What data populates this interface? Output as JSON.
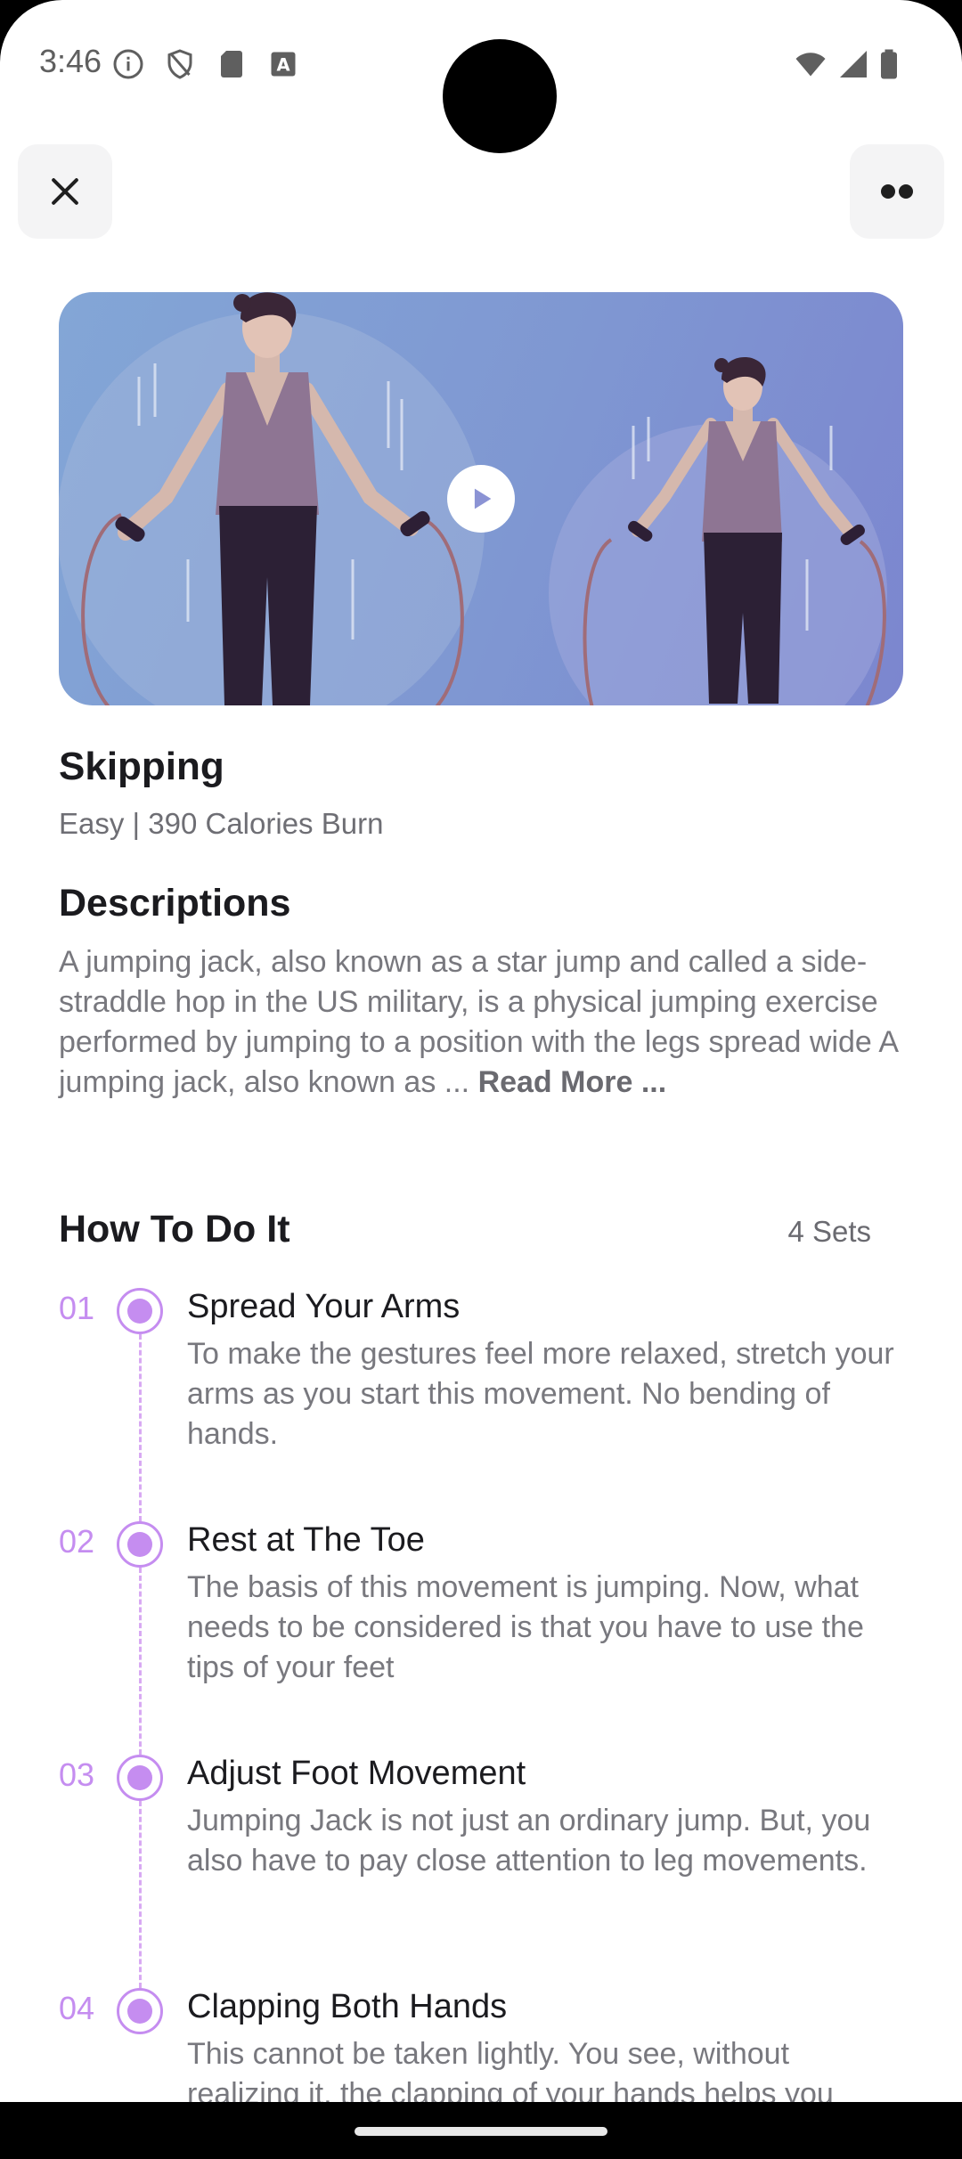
{
  "status": {
    "time": "3:46"
  },
  "exercise": {
    "title": "Skipping",
    "subtitle": "Easy | 390 Calories Burn"
  },
  "descriptions": {
    "heading": "Descriptions",
    "text": "A jumping jack, also known as a star jump and called a side-straddle hop in the US military, is a physical jumping exercise performed by jumping to a position with the legs spread wide A jumping jack, also known as ... ",
    "read_more": "Read More ..."
  },
  "howto": {
    "heading": "How To Do It",
    "sets": "4 Sets",
    "steps": [
      {
        "num": "01",
        "title": "Spread Your Arms",
        "text": "To make the gestures feel more relaxed, stretch your arms as you start this movement. No bending of hands."
      },
      {
        "num": "02",
        "title": "Rest at The Toe",
        "text": "The basis of this movement is jumping. Now, what needs to be considered is that you have to use the tips of your feet"
      },
      {
        "num": "03",
        "title": "Adjust Foot Movement",
        "text": "Jumping Jack is not just an ordinary jump. But, you also have to pay close attention to leg movements."
      },
      {
        "num": "04",
        "title": "Clapping Both Hands",
        "text": "This cannot be taken lightly. You see, without realizing it, the clapping of your hands helps you"
      }
    ]
  },
  "icons": {
    "close": "close-icon",
    "more": "more-icon",
    "play": "play-icon"
  },
  "colors": {
    "accent": "#c58df0",
    "hero_start": "#83a6d6",
    "hero_end": "#7c86cf"
  }
}
